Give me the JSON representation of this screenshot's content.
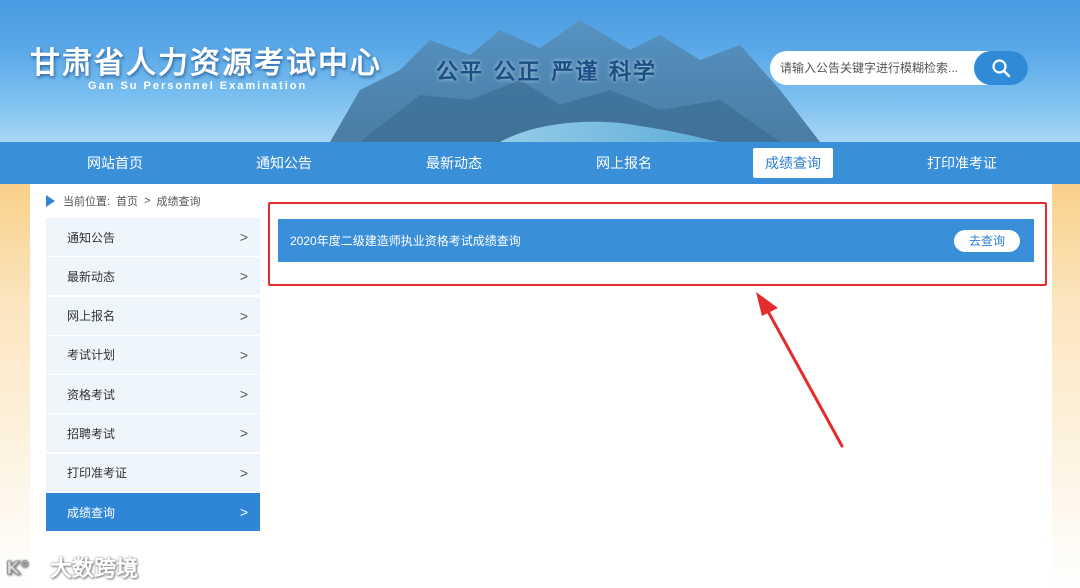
{
  "header": {
    "title": "甘肃省人力资源考试中心",
    "subtitle": "Gan Su Personnel Examination",
    "slogan": "公平 公正 严谨 科学",
    "search": {
      "placeholder": "请输入公告关键字进行模糊检索..."
    }
  },
  "nav": {
    "items": [
      {
        "label": "网站首页"
      },
      {
        "label": "通知公告"
      },
      {
        "label": "最新动态"
      },
      {
        "label": "网上报名"
      },
      {
        "label": "成绩查询",
        "active": true
      },
      {
        "label": "打印准考证"
      }
    ]
  },
  "breadcrumb": {
    "prefix": "当前位置:",
    "home": "首页",
    "separator": ">",
    "current": "成绩查询"
  },
  "sidebar": {
    "items": [
      {
        "label": "通知公告"
      },
      {
        "label": "最新动态"
      },
      {
        "label": "网上报名"
      },
      {
        "label": "考试计划"
      },
      {
        "label": "资格考试"
      },
      {
        "label": "招聘考试"
      },
      {
        "label": "打印准考证"
      },
      {
        "label": "成绩查询",
        "active": true
      }
    ],
    "chevron": ">"
  },
  "result": {
    "title": "2020年度二级建造师执业资格考试成绩查询",
    "button": "去查询"
  },
  "watermark": "大数跨境",
  "colors": {
    "primary": "#3a8fd9",
    "highlight": "#e52b2b",
    "sidebar_bg": "#eef5fd"
  }
}
